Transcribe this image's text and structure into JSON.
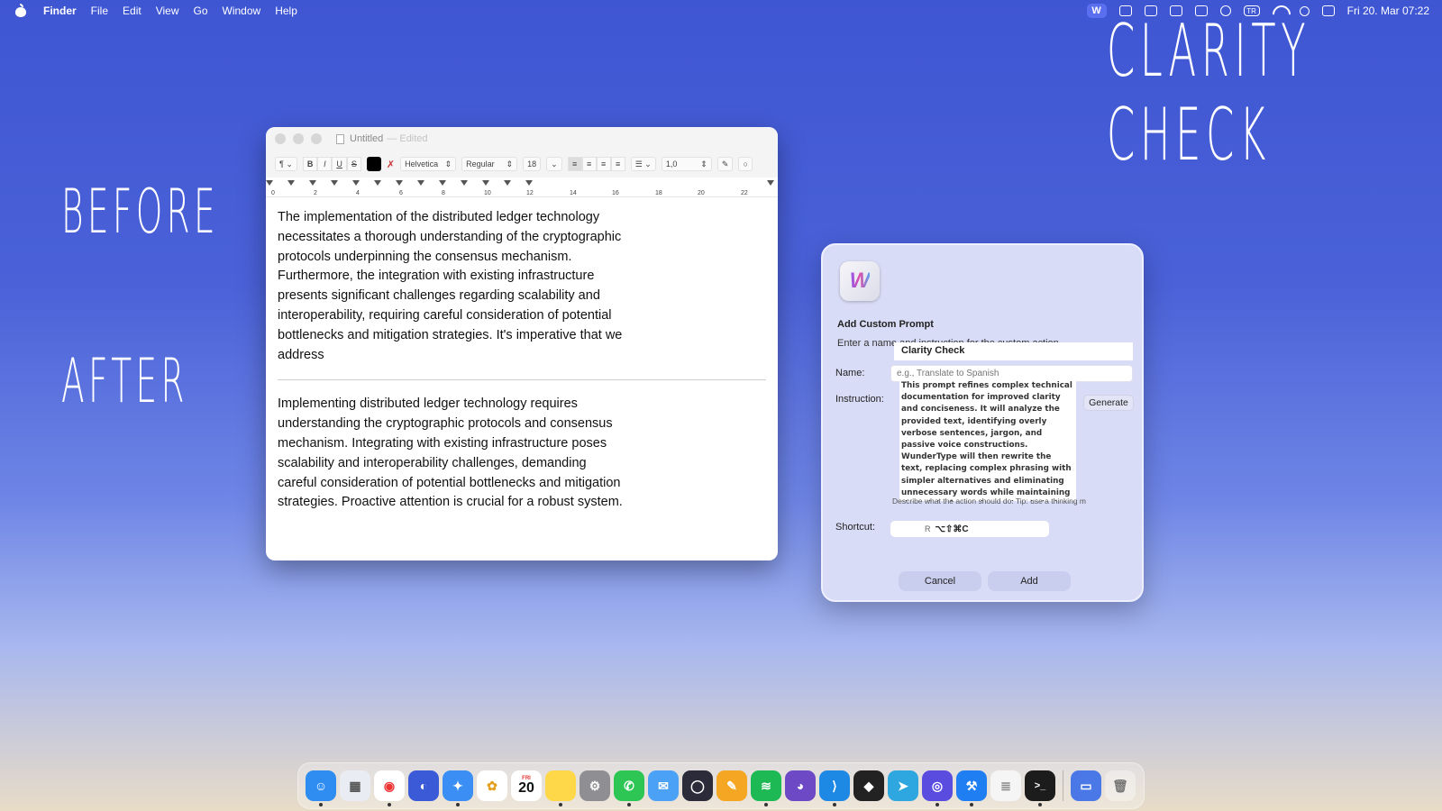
{
  "menubar": {
    "app_name": "Finder",
    "items": [
      "File",
      "Edit",
      "View",
      "Go",
      "Window",
      "Help"
    ],
    "clock": "Fri 20. Mar 07:22",
    "status_w": "W",
    "status_tr": "TR"
  },
  "overlay": {
    "title": "CLARITY CHECK",
    "before": "BEFORE",
    "after": "AFTER"
  },
  "textedit": {
    "title": "Untitled",
    "edited": "— Edited",
    "toolbar": {
      "paragraph": "¶",
      "bold": "B",
      "italic": "I",
      "underline": "U",
      "strike": "S",
      "font_family": "Helvetica",
      "font_style": "Regular",
      "font_size": "18",
      "line_spacing": "1,0"
    },
    "ruler_numbers": [
      "0",
      "2",
      "4",
      "6",
      "8",
      "10",
      "12",
      "14",
      "16",
      "18",
      "20",
      "22"
    ],
    "before_text": "The implementation of the distributed ledger technology necessitates a thorough understanding of the cryptographic protocols underpinning the consensus mechanism. Furthermore, the integration with existing infrastructure presents significant challenges regarding scalability and interoperability, requiring careful consideration of potential bottlenecks and mitigation strategies.  It's imperative that we address",
    "after_text": "Implementing distributed ledger technology requires understanding the cryptographic protocols and consensus mechanism. Integrating with existing infrastructure poses scalability and interoperability challenges, demanding careful consideration of potential bottlenecks and mitigation strategies. Proactive attention is crucial for a robust system."
  },
  "dialog": {
    "app_icon_letter": "W",
    "title": "Add Custom Prompt",
    "subtitle": "Enter a name and instruction for the custom action",
    "autocomplete": "Clarity Check",
    "name_label": "Name:",
    "name_placeholder": "e.g., Translate to Spanish",
    "instruction_label": "Instruction:",
    "instruction_text": "This prompt refines complex technical documentation for improved clarity and conciseness. It will analyze the provided text, identifying overly verbose sentences, jargon, and passive voice constructions. WunderType will then rewrite the text, replacing complex phrasing with simpler alternatives and eliminating unnecessary words while maintaining the original meaning and technical accuracy. The output will",
    "generate_label": "Generate",
    "hint": "Describe what the action should do. Tip: use a thinking m",
    "shortcut_label": "Shortcut:",
    "shortcut_prefix": "R",
    "shortcut_keys": "⌥⇧⌘C",
    "cancel_label": "Cancel",
    "add_label": "Add"
  },
  "dock": {
    "calendar_month": "FRI",
    "calendar_day": "20",
    "apps": [
      {
        "name": "finder",
        "color": "#2f8cf0"
      },
      {
        "name": "launchpad",
        "color": "#e9ecf3"
      },
      {
        "name": "chrome",
        "color": "#ffffff"
      },
      {
        "name": "firefox",
        "color": "#3a5ad8"
      },
      {
        "name": "safari",
        "color": "#3b8ef3"
      },
      {
        "name": "photos",
        "color": "#ffffff"
      },
      {
        "name": "calendar",
        "color": "#ffffff"
      },
      {
        "name": "notes",
        "color": "#ffd84a"
      },
      {
        "name": "settings",
        "color": "#8e8e93"
      },
      {
        "name": "whatsapp",
        "color": "#2dc654"
      },
      {
        "name": "mail",
        "color": "#4aa1f6"
      },
      {
        "name": "arc",
        "color": "#2b2b3a"
      },
      {
        "name": "pages",
        "color": "#f5a623"
      },
      {
        "name": "spotify",
        "color": "#1db954"
      },
      {
        "name": "github",
        "color": "#6e49c6"
      },
      {
        "name": "vscode",
        "color": "#1e88e5"
      },
      {
        "name": "cube",
        "color": "#222222"
      },
      {
        "name": "telegram",
        "color": "#2ea6e0"
      },
      {
        "name": "proton",
        "color": "#5b4ce0"
      },
      {
        "name": "xcode",
        "color": "#1e7ef2"
      },
      {
        "name": "textedit",
        "color": "#f5f5f5"
      },
      {
        "name": "terminal",
        "color": "#1c1c1c"
      }
    ]
  }
}
